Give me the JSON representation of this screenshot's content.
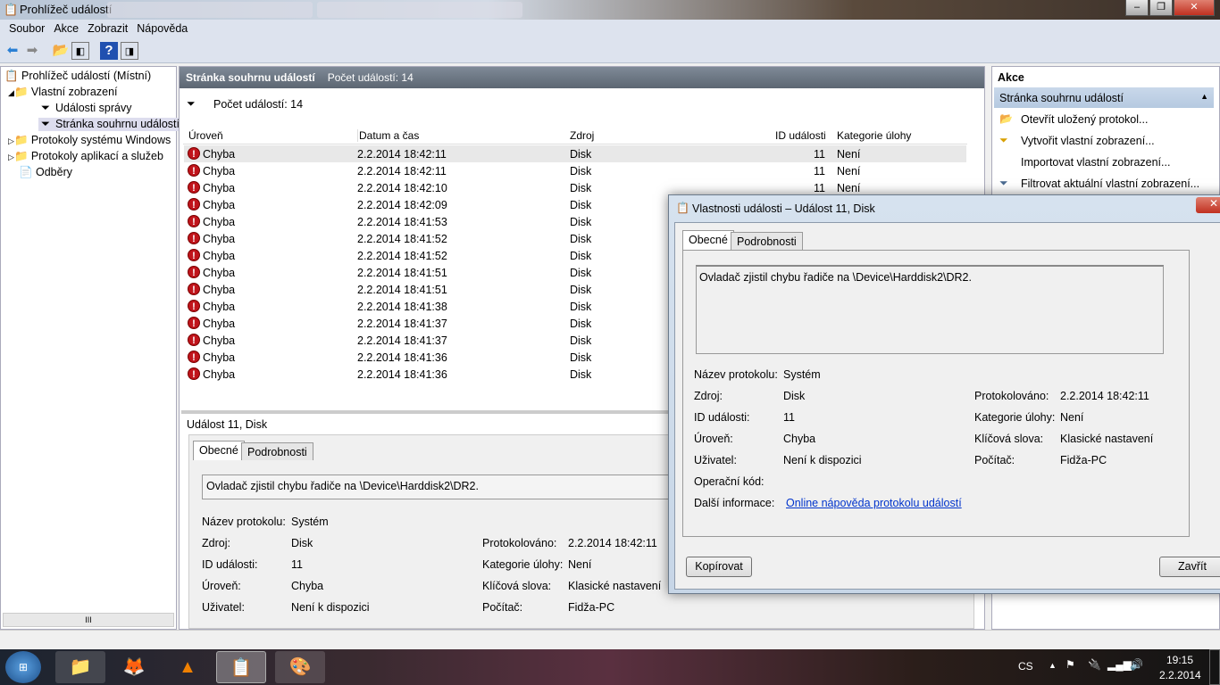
{
  "window": {
    "title": "Prohlížeč událostí"
  },
  "menu": [
    "Soubor",
    "Akce",
    "Zobrazit",
    "Nápověda"
  ],
  "tree": [
    {
      "label": "Prohlížeč událostí (Místní)"
    },
    {
      "label": "Vlastní zobrazení"
    },
    {
      "label": "Události správy"
    },
    {
      "label": "Stránka souhrnu událostí"
    },
    {
      "label": "Protokoly systému Windows"
    },
    {
      "label": "Protokoly aplikací a služeb"
    },
    {
      "label": "Odběry"
    }
  ],
  "center": {
    "header": "Stránka souhrnu událostí",
    "header_count": "Počet událostí: 14",
    "filter_count": "Počet událostí: 14",
    "columns": [
      "Úroveň",
      "Datum a čas",
      "Zdroj",
      "ID události",
      "Kategorie úlohy"
    ],
    "rows": [
      [
        "Chyba",
        "2.2.2014 18:42:11",
        "Disk",
        "11",
        "Není"
      ],
      [
        "Chyba",
        "2.2.2014 18:42:11",
        "Disk",
        "11",
        "Není"
      ],
      [
        "Chyba",
        "2.2.2014 18:42:10",
        "Disk",
        "11",
        "Není"
      ],
      [
        "Chyba",
        "2.2.2014 18:42:09",
        "Disk",
        "",
        ""
      ],
      [
        "Chyba",
        "2.2.2014 18:41:53",
        "Disk",
        "",
        ""
      ],
      [
        "Chyba",
        "2.2.2014 18:41:52",
        "Disk",
        "",
        ""
      ],
      [
        "Chyba",
        "2.2.2014 18:41:52",
        "Disk",
        "",
        ""
      ],
      [
        "Chyba",
        "2.2.2014 18:41:51",
        "Disk",
        "",
        ""
      ],
      [
        "Chyba",
        "2.2.2014 18:41:51",
        "Disk",
        "",
        ""
      ],
      [
        "Chyba",
        "2.2.2014 18:41:38",
        "Disk",
        "",
        ""
      ],
      [
        "Chyba",
        "2.2.2014 18:41:37",
        "Disk",
        "",
        ""
      ],
      [
        "Chyba",
        "2.2.2014 18:41:37",
        "Disk",
        "",
        ""
      ],
      [
        "Chyba",
        "2.2.2014 18:41:36",
        "Disk",
        "",
        ""
      ],
      [
        "Chyba",
        "2.2.2014 18:41:36",
        "Disk",
        "",
        ""
      ]
    ],
    "detail_title": "Událost 11, Disk",
    "tabs": [
      "Obecné",
      "Podrobnosti"
    ],
    "message": "Ovladač zjistil chybu řadiče na \\Device\\Harddisk2\\DR2.",
    "fields": {
      "log_l": "Název protokolu:",
      "log": "Systém",
      "src_l": "Zdroj:",
      "src": "Disk",
      "logged_l": "Protokolováno:",
      "logged": "2.2.2014 18:42:11",
      "id_l": "ID události:",
      "id": "11",
      "cat_l": "Kategorie úlohy:",
      "cat": "Není",
      "lvl_l": "Úroveň:",
      "lvl": "Chyba",
      "kw_l": "Klíčová slova:",
      "kw": "Klasické nastavení",
      "user_l": "Uživatel:",
      "user": "Není k dispozici",
      "pc_l": "Počítač:",
      "pc": "Fidža-PC"
    }
  },
  "actions": {
    "title": "Akce",
    "section": "Stránka souhrnu událostí",
    "items": [
      "Otevřít uložený protokol...",
      "Vytvořit vlastní zobrazení...",
      "Importovat vlastní zobrazení...",
      "Filtrovat aktuální vlastní zobrazení..."
    ]
  },
  "dialog": {
    "title": "Vlastnosti události – Událost 11, Disk",
    "opcode_l": "Operační kód:",
    "more_l": "Další informace:",
    "more_link": "Online nápověda protokolu událostí",
    "copy": "Kopírovat",
    "close": "Zavřít"
  },
  "tray": {
    "lang": "CS",
    "time": "19:15",
    "date": "2.2.2014"
  },
  "scrollbar_grip": "III"
}
